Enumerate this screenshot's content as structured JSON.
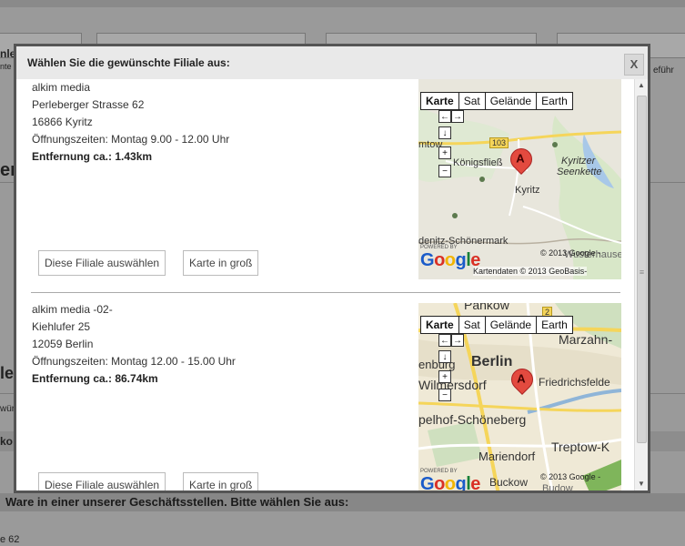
{
  "background": {
    "left_fragments": [
      "nle",
      "nte",
      "en",
      "le",
      "wür",
      "ko"
    ],
    "right_fragment": "eführ",
    "banner_text": "Ware in einer unserer Geschäftsstellen. Bitte wählen Sie aus:",
    "bottom_fragment": "e 62"
  },
  "modal": {
    "title": "Wählen Sie die gewünschte Filiale aus:",
    "close_label": "X",
    "branches": [
      {
        "name": "alkim media",
        "street": "Perleberger Strasse 62",
        "city": "16866 Kyritz",
        "hours": "Öffnungszeiten: Montag 9.00 - 12.00 Uhr",
        "distance": "Entfernung ca.: 1.43km",
        "select_label": "Diese Filiale auswählen",
        "map_label": "Karte in groß",
        "map": {
          "types": [
            "Karte",
            "Sat",
            "Gelände",
            "Earth"
          ],
          "active_type": "Karte",
          "marker": "A",
          "places": [
            "mtow",
            "Königsfließ",
            "Kyritzer",
            "Seenkette",
            "Kyritz",
            "103",
            "denitz-Schönermark",
            "Wusterhausen/"
          ],
          "powered": "POWERED BY",
          "google": "Google",
          "copyright": "© 2013 Google -",
          "attribution": "Kartendaten © 2013 GeoBasis-"
        }
      },
      {
        "name": "alkim media -02-",
        "street": "Kiehlufer 25",
        "city": "12059 Berlin",
        "hours": "Öffnungszeiten: Montag 12.00 - 15.00 Uhr",
        "distance": "Entfernung ca.: 86.74km",
        "select_label": "Diese Filiale auswählen",
        "map_label": "Karte in groß",
        "map": {
          "types": [
            "Karte",
            "Sat",
            "Gelände",
            "Earth"
          ],
          "active_type": "Karte",
          "marker": "A",
          "places": [
            "Pankow",
            "Marzahn-",
            "Berlin",
            "Wilmersdorf",
            "Friedrichsfelde",
            "pelhof-Schöneberg",
            "Treptow-K",
            "Mariendorf",
            "Buckow",
            "Budow",
            "enburg",
            "2"
          ],
          "powered": "POWERED BY",
          "google": "Google",
          "copyright": "© 2013 Google -"
        }
      }
    ]
  }
}
